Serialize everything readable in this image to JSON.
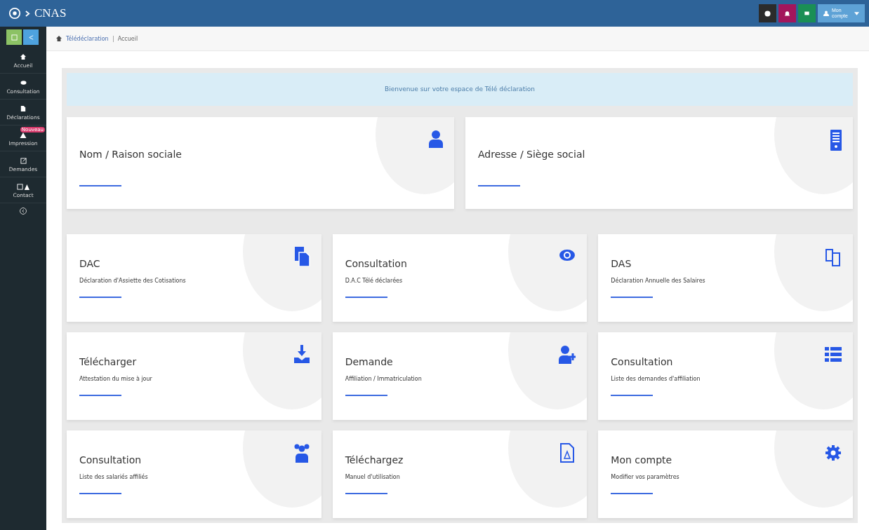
{
  "topbar": {
    "brand": "CNAS",
    "user_menu": "Mon compte"
  },
  "sidebar": {
    "items": [
      {
        "label": "Accueil",
        "selected": false
      },
      {
        "label": "Consultation",
        "selected": false
      },
      {
        "label": "Déclarations",
        "selected": false
      },
      {
        "label": "Impression",
        "selected": false,
        "badge": "Nouveau"
      },
      {
        "label": "Demandes",
        "selected": false
      },
      {
        "label": "Contact",
        "selected": false
      }
    ]
  },
  "breadcrumb": [
    "Télédéclaration",
    "Accueil"
  ],
  "welcome": "Bienvenue sur votre espace de Télé déclaration",
  "info_cards": [
    {
      "title": "Nom / Raison sociale"
    },
    {
      "title": "Adresse / Siège social"
    }
  ],
  "cards": [
    {
      "title": "DAC",
      "subtitle": "Déclaration d'Assiette des Cotisations"
    },
    {
      "title": "Consultation",
      "subtitle": "D.A.C Télé déclarées"
    },
    {
      "title": "DAS",
      "subtitle": "Déclaration Annuelle des Salaires"
    },
    {
      "title": "Télécharger",
      "subtitle": "Attestation du mise à jour"
    },
    {
      "title": "Demande",
      "subtitle": "Affiliation / Immatriculation"
    },
    {
      "title": "Consultation",
      "subtitle": "Liste des demandes d'affiliation"
    },
    {
      "title": "Consultation",
      "subtitle": "Liste des salariés affiliés"
    },
    {
      "title": "Téléchargez",
      "subtitle": "Manuel d'utilisation"
    },
    {
      "title": "Mon compte",
      "subtitle": "Modifier vos paramètres"
    }
  ]
}
